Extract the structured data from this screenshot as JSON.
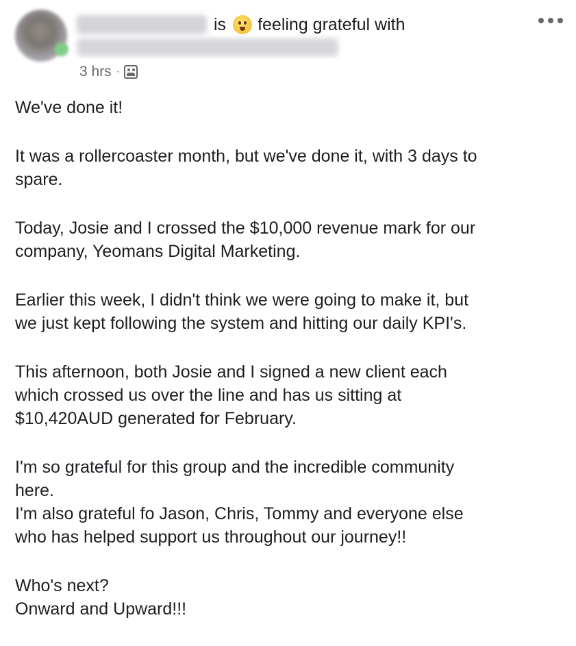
{
  "header": {
    "feeling_prefix": "is",
    "feeling_emoji": "grinning-sweat-emoji",
    "feeling_text": "feeling grateful with",
    "time": "3 hrs",
    "separator": "·",
    "audience_icon": "group-audience-icon",
    "menu_icon": "more-options-icon"
  },
  "post": {
    "paragraphs": [
      {
        "lines": [
          "We've done it!"
        ]
      },
      {
        "lines": [
          "It was a rollercoaster month, but we've done it, with 3 days to",
          "spare."
        ]
      },
      {
        "lines": [
          "Today, Josie and I crossed the $10,000 revenue mark for our",
          "company, Yeomans Digital Marketing."
        ]
      },
      {
        "lines": [
          "Earlier this week, I didn't think we were going to make it, but",
          "we just kept following the system and hitting our daily KPI's."
        ]
      },
      {
        "lines": [
          "This afternoon, both Josie and I signed a new client each",
          "which crossed us over the line and has us sitting at",
          "$10,420AUD generated for February."
        ]
      },
      {
        "lines": [
          "I'm so grateful for this group and the incredible community",
          "here.",
          "I'm also grateful fo Jason, Chris, Tommy and everyone else",
          "who has helped support us throughout our journey!!"
        ]
      },
      {
        "lines": [
          "Who's next?",
          "Onward and Upward!!!"
        ]
      }
    ]
  },
  "colors": {
    "text": "#1c1e21",
    "meta": "#65676b",
    "background": "#ffffff"
  }
}
